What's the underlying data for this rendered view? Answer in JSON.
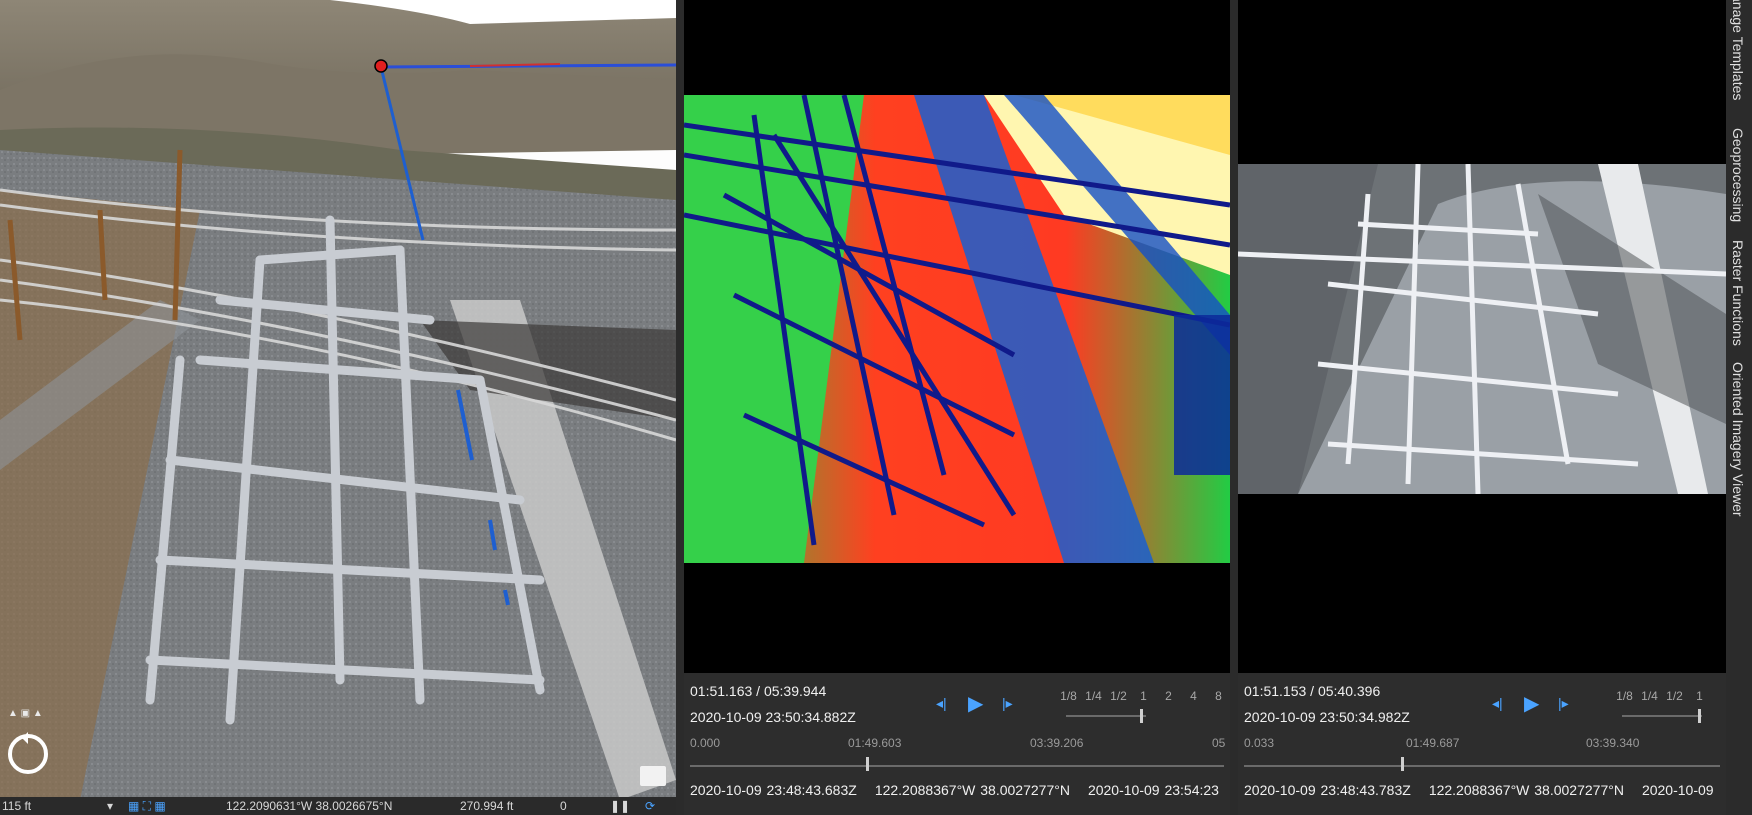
{
  "scene_view": {
    "scale": "115 ft",
    "coordinates": "122.2090631°W 38.0026675°N",
    "elevation": "270.994 ft",
    "selected_count": "0"
  },
  "thermal_viewer": {
    "current_time": "01:51.163 / 05:39.944",
    "timestamp": "2020-10-09 23:50:34.882Z",
    "speeds": [
      "1/8",
      "1/4",
      "1/2",
      "1",
      "2",
      "4",
      "8"
    ],
    "ticks": [
      "0.000",
      "01:49.603",
      "03:39.206",
      "05"
    ],
    "progress": 0.33,
    "footer_time": "2020-10-09 23:48:43.683Z",
    "footer_coords": "122.2088367°W 38.0027277°N",
    "footer_end": "2020-10-09 23:54:23"
  },
  "rgb_viewer": {
    "current_time": "01:51.153 / 05:40.396",
    "timestamp": "2020-10-09 23:50:34.982Z",
    "speeds": [
      "1/8",
      "1/4",
      "1/2",
      "1"
    ],
    "ticks": [
      "0.033",
      "01:49.687",
      "03:39.340"
    ],
    "progress": 0.33,
    "footer_time": "2020-10-09 23:48:43.783Z",
    "footer_coords": "122.2088367°W 38.0027277°N",
    "footer_end": "2020-10-09"
  },
  "right_panel_tabs": [
    "Oriented Imagery Viewer",
    "Raster Functions",
    "Geoprocessing",
    "anage Templates"
  ]
}
